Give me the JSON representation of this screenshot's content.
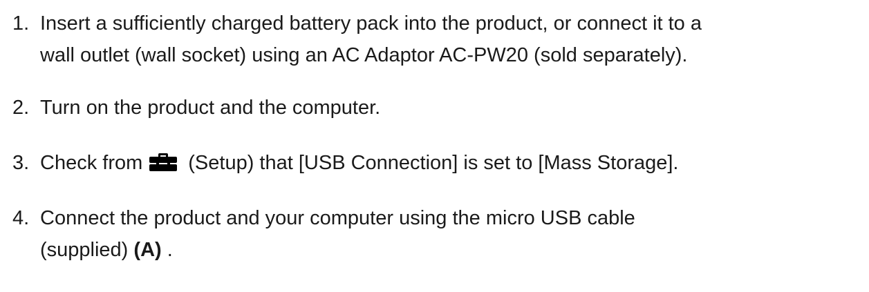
{
  "steps": [
    {
      "number": "1.",
      "line1": "Insert a sufficiently charged battery pack into the product, or connect it to a",
      "line2": "wall outlet (wall socket) using an AC Adaptor AC-PW20 (sold separately)."
    },
    {
      "number": "2.",
      "text": "Turn on the product and the computer."
    },
    {
      "number": "3.",
      "before_icon": "Check from",
      "icon": "toolbox-setup-icon",
      "after_icon": "(Setup) that [USB Connection] is set to [Mass Storage]."
    },
    {
      "number": "4.",
      "line1": "Connect the product and your computer using the micro USB cable",
      "line2_before": "(supplied) ",
      "line2_bold": "(A)",
      "line2_after": " ."
    }
  ]
}
